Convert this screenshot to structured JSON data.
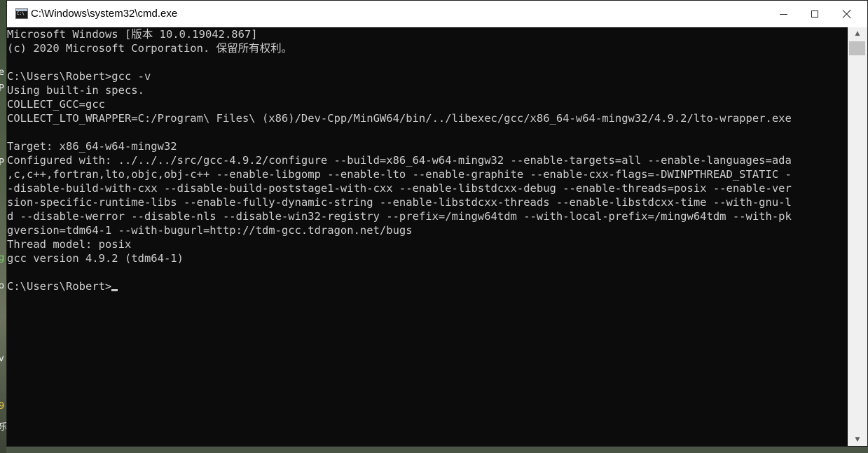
{
  "window": {
    "title": "C:\\Windows\\system32\\cmd.exe",
    "icon": "console-icon"
  },
  "desktop": {
    "left_glyphs": [
      "e",
      "P",
      "P",
      "g",
      "o",
      "v",
      "9",
      "乐"
    ]
  },
  "console": {
    "lines": [
      "Microsoft Windows [版本 10.0.19042.867]",
      "(c) 2020 Microsoft Corporation. 保留所有权利。",
      "",
      "C:\\Users\\Robert>gcc -v",
      "Using built-in specs.",
      "COLLECT_GCC=gcc",
      "COLLECT_LTO_WRAPPER=C:/Program\\ Files\\ (x86)/Dev-Cpp/MinGW64/bin/../libexec/gcc/x86_64-w64-mingw32/4.9.2/lto-wrapper.exe",
      "",
      "Target: x86_64-w64-mingw32",
      "Configured with: ../../../src/gcc-4.9.2/configure --build=x86_64-w64-mingw32 --enable-targets=all --enable-languages=ada",
      ",c,c++,fortran,lto,objc,obj-c++ --enable-libgomp --enable-lto --enable-graphite --enable-cxx-flags=-DWINPTHREAD_STATIC -",
      "-disable-build-with-cxx --disable-build-poststage1-with-cxx --enable-libstdcxx-debug --enable-threads=posix --enable-ver",
      "sion-specific-runtime-libs --enable-fully-dynamic-string --enable-libstdcxx-threads --enable-libstdcxx-time --with-gnu-l",
      "d --disable-werror --disable-nls --disable-win32-registry --prefix=/mingw64tdm --with-local-prefix=/mingw64tdm --with-pk",
      "gversion=tdm64-1 --with-bugurl=http://tdm-gcc.tdragon.net/bugs",
      "Thread model: posix",
      "gcc version 4.9.2 (tdm64-1)",
      ""
    ],
    "prompt": "C:\\Users\\Robert>"
  }
}
